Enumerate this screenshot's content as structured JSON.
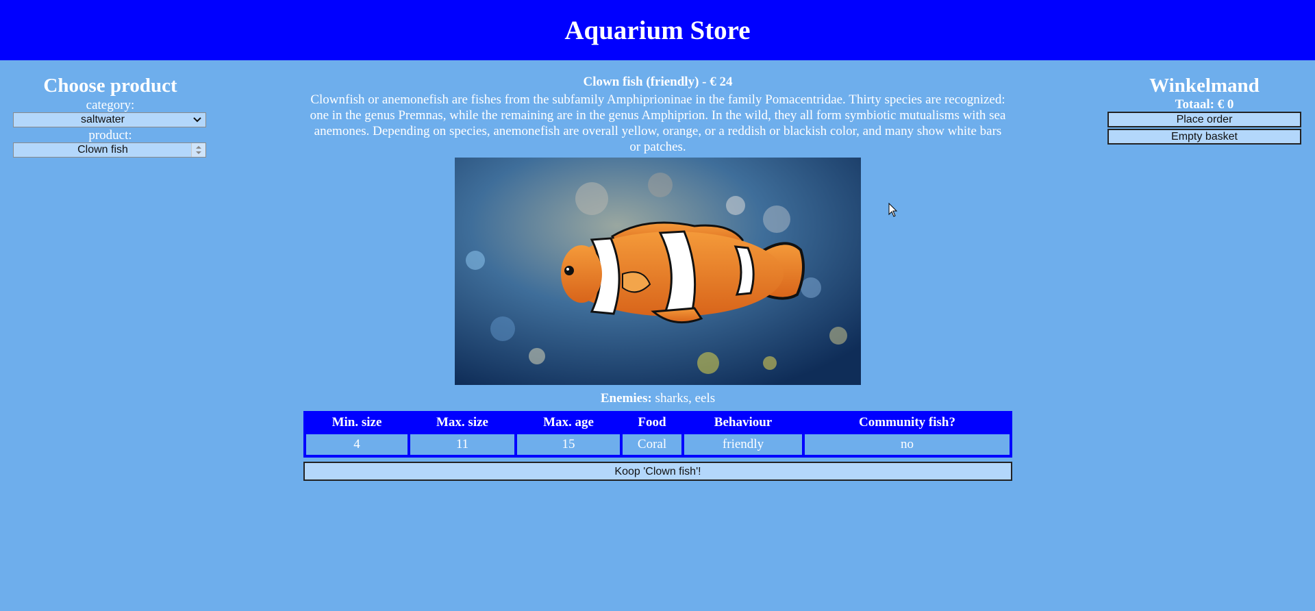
{
  "app": {
    "title": "Aquarium Store"
  },
  "left": {
    "heading": "Choose product",
    "category_label": "category:",
    "category_value": "saltwater",
    "product_label": "product:",
    "product_value": "Clown fish"
  },
  "cart": {
    "heading": "Winkelmand",
    "total": "Totaal: € 0",
    "place_order": "Place order",
    "empty_basket": "Empty basket"
  },
  "product": {
    "title": "Clown fish (friendly) - € 24",
    "description": "Clownfish or anemonefish are fishes from the subfamily Amphiprioninae in the family Pomacentridae. Thirty species are recognized: one in the genus Premnas, while the remaining are in the genus Amphiprion. In the wild, they all form symbiotic mutualisms with sea anemones. Depending on species, anemonefish are overall yellow, orange, or a reddish or blackish color, and many show white bars or patches.",
    "enemies_label": "Enemies:",
    "enemies_value": " sharks, eels",
    "buy_label": "Koop 'Clown fish'!"
  },
  "table": {
    "headers": [
      "Min. size",
      "Max. size",
      "Max. age",
      "Food",
      "Behaviour",
      "Community fish?"
    ],
    "row": [
      "4",
      "11",
      "15",
      "Coral",
      "friendly",
      "no"
    ]
  },
  "colors": {
    "background": "#6eaeec",
    "header": "#0000ff",
    "control": "#b3d7fb"
  }
}
